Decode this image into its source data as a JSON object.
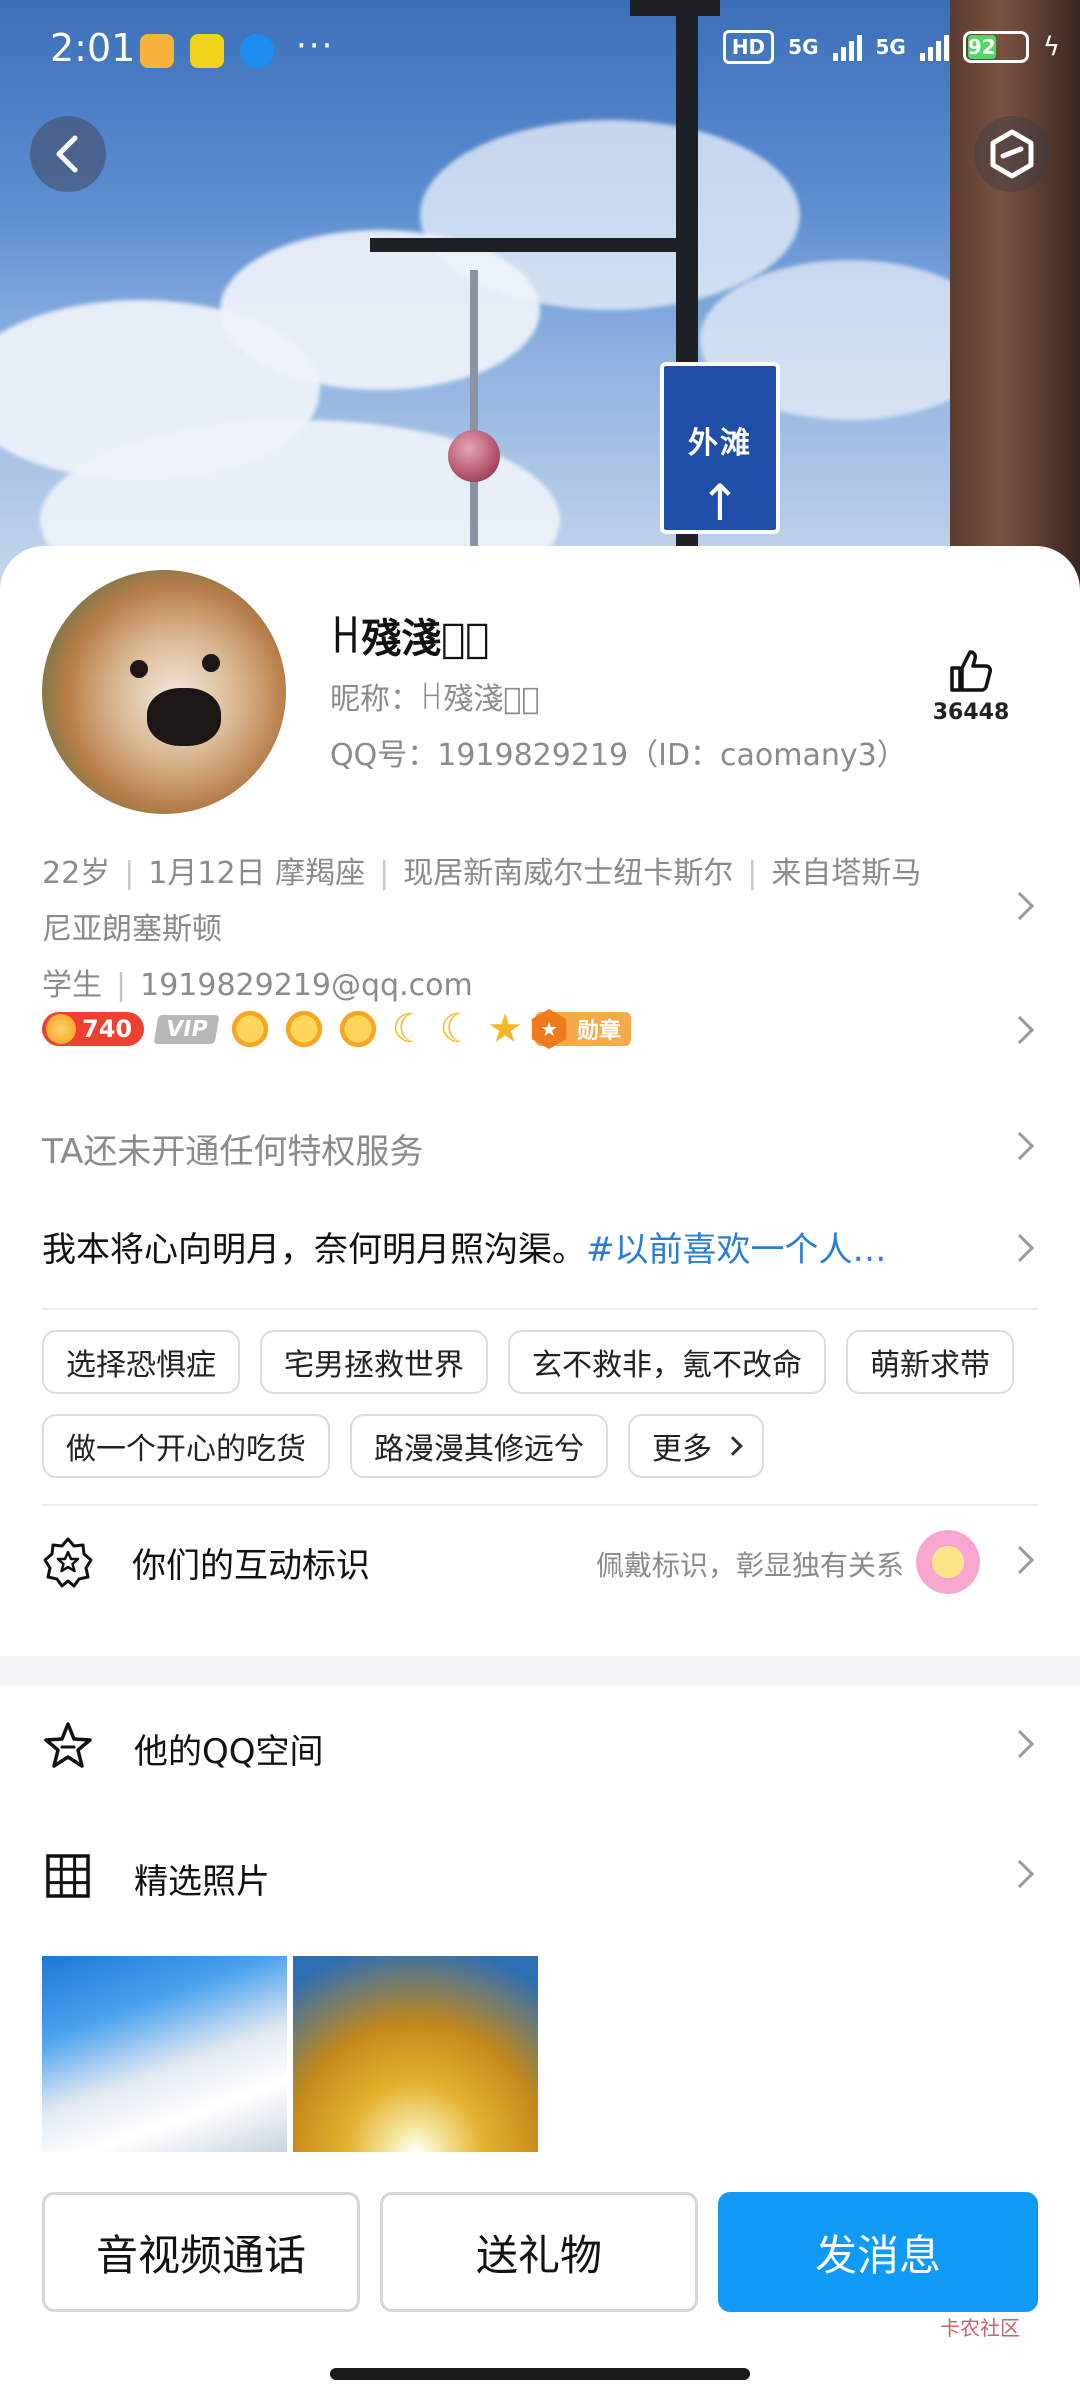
{
  "status_bar": {
    "time": "2:01",
    "more": "···",
    "hd": "HD",
    "sig1": "5G",
    "sig2": "5G",
    "battery": "92",
    "colors": {
      "battery_fill": "#4cd964"
    }
  },
  "cover": {
    "sign_text": "外滩",
    "sign_arrow": "↑",
    "back_icon": "back-arrow-icon",
    "settings_icon": "hexagon-settings-icon"
  },
  "profile": {
    "name": "ꀿ殘淺ꦿ゚",
    "nickname": "昵称：ꀿ殘淺ꦿ゚",
    "qq": "QQ号：1919829219（ID：caomany3）",
    "likes": "36448",
    "info": [
      "22岁",
      "1月12日 摩羯座",
      "现居新南威尔士纽卡斯尔",
      "来自塔斯马尼亚朗塞斯顿",
      "学生",
      "1919829219@qq.com"
    ]
  },
  "badges": {
    "level": "740",
    "vip": "VIP",
    "medal": "勋章"
  },
  "privilege_text": "TA还未开通任何特权服务",
  "signature": {
    "text": "我本将心向明月，奈何明月照沟渠。",
    "tag": "#以前喜欢一个人…"
  },
  "tags": [
    "选择恐惧症",
    "宅男拯救世界",
    "玄不救非，氪不改命",
    "萌新求带",
    "做一个开心的吃货",
    "路漫漫其修远兮",
    "更多"
  ],
  "interaction": {
    "label": "你们的互动标识",
    "hint": "佩戴标识，彰显独有关系"
  },
  "menu": {
    "qzone": "他的QQ空间",
    "photos": "精选照片"
  },
  "actions": {
    "call": "音视频通话",
    "gift": "送礼物",
    "message": "发消息"
  },
  "watermark": "卡农社区",
  "colors": {
    "accent": "#0f9af6",
    "tag_link": "#2c7dd6",
    "level_red": "#ef3f2f"
  }
}
